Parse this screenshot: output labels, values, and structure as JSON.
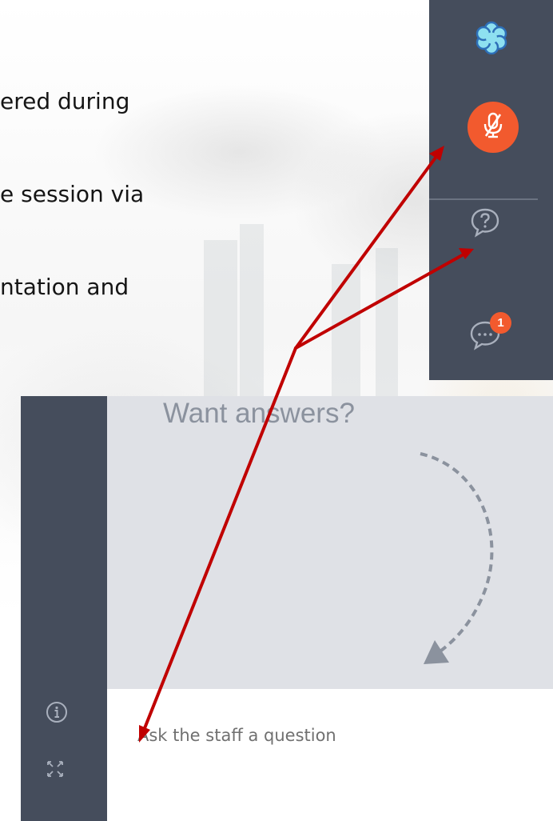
{
  "slide": {
    "lines": [
      "ered during",
      "e session via",
      "ntation and"
    ]
  },
  "toolbar": {
    "logo_icon": "flower-logo-icon",
    "mic_icon": "microphone-muted-icon",
    "qa_icon": "question-bubble-icon",
    "chat_icon": "chat-bubble-icon",
    "chat_badge_count": "1",
    "accent_color": "#f25a2e",
    "background_color": "#454d5c"
  },
  "qa_panel": {
    "empty_hint": "Want answers?",
    "input_placeholder": "Ask the staff a question",
    "info_icon": "info-icon",
    "expand_icon": "expand-icon"
  },
  "annotation_color": "#c00000"
}
